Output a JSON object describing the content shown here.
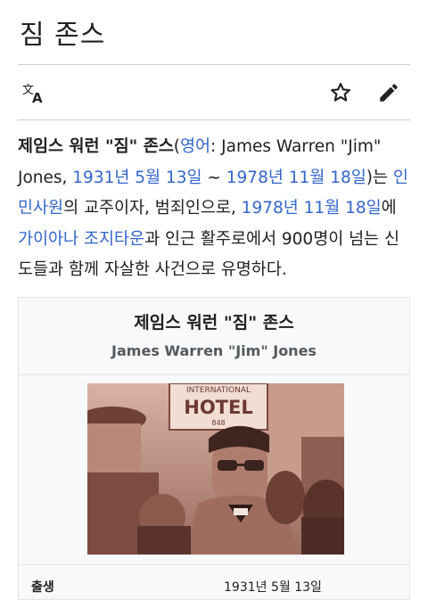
{
  "page": {
    "title": "짐 존스"
  },
  "toolbar": {
    "language_icon": "translate-icon",
    "watch_icon": "star-outline-icon",
    "edit_icon": "pencil-icon"
  },
  "lead": {
    "name_bold": "제임스 워런 \"짐\" 존스",
    "paren_open": "(",
    "lang_link": "영어",
    "english_name": ": James Warren \"Jim\" Jones, ",
    "birth_link": "1931년 5월 13일",
    "tilde": " ~ ",
    "death_link": "1978년 11월 18일",
    "after_death": ")는 ",
    "temple_link": "인민사원",
    "middle": "의 교주이자, 범죄인으로, ",
    "date_link": "1978년 11월 18일",
    "after_date": "에 ",
    "guyana_link": "가이아나",
    "space": " ",
    "georgetown_link": "조지타운",
    "ending": "과 인근 활주로에서 900명이 넘는 신도들과 함께 자살한 사건으로 유명하다."
  },
  "infobox": {
    "title": "제임스 워런 \"짐\" 존스",
    "subtitle": "James Warren \"Jim\" Jones",
    "photo_sign": "INTERNATIONAL",
    "photo_sign2": "HOTEL",
    "photo_sign_num": "848",
    "row_label": "출생",
    "row_value": "1931년 5월 13일"
  },
  "colors": {
    "link": "#3366cc",
    "text": "#202122",
    "rule": "#c8ccd1",
    "infobox_bg": "#f8f9fa"
  }
}
